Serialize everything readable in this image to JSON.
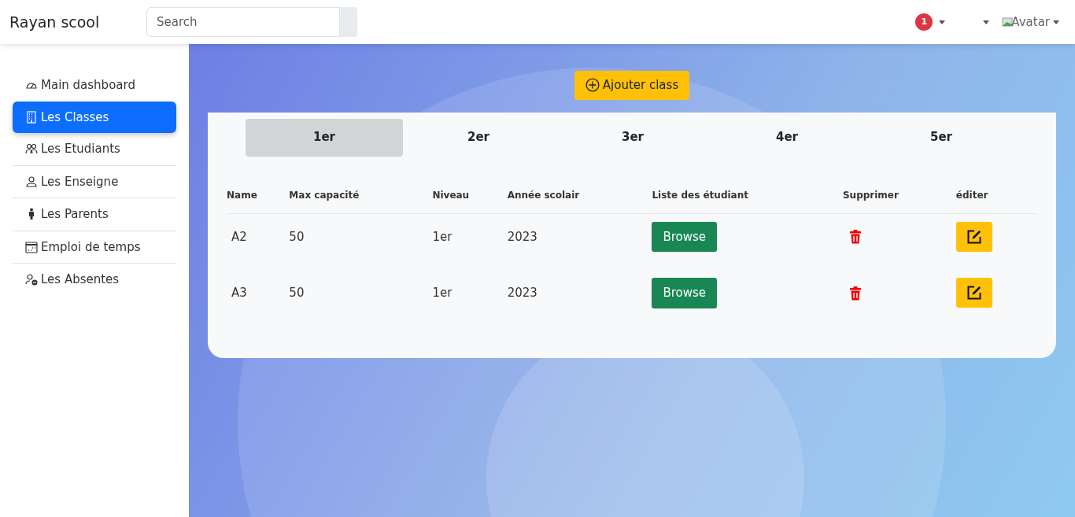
{
  "navbar": {
    "brand": "Rayan scool",
    "search": {
      "placeholder": "Search"
    },
    "notification_count": "1",
    "avatar_alt": "Avatar"
  },
  "sidebar": {
    "items": [
      {
        "label": "Main dashboard",
        "selected": false
      },
      {
        "label": "Les Classes",
        "selected": true
      },
      {
        "label": "Les Etudiants",
        "selected": false
      },
      {
        "label": "Les Enseigne",
        "selected": false
      },
      {
        "label": "Les Parents",
        "selected": false
      },
      {
        "label": "Emploi de temps",
        "selected": false
      },
      {
        "label": "Les Absentes",
        "selected": false
      }
    ]
  },
  "add_button": "Ajouter class",
  "tabs": [
    {
      "label": "1er",
      "selected": true
    },
    {
      "label": "2er",
      "selected": false
    },
    {
      "label": "3er",
      "selected": false
    },
    {
      "label": "4er",
      "selected": false
    },
    {
      "label": "5er",
      "selected": false
    }
  ],
  "table": {
    "columns": [
      "Name",
      "Max capacité",
      "Niveau",
      "Année scolair",
      "Liste des étudiant",
      "Supprimer",
      "éditer"
    ],
    "rows": [
      {
        "name": "A2",
        "max": "50",
        "niveau": "1er",
        "annee": "2023",
        "browse": "Browse"
      },
      {
        "name": "A3",
        "max": "50",
        "niveau": "1er",
        "annee": "2023",
        "browse": "Browse"
      }
    ]
  }
}
